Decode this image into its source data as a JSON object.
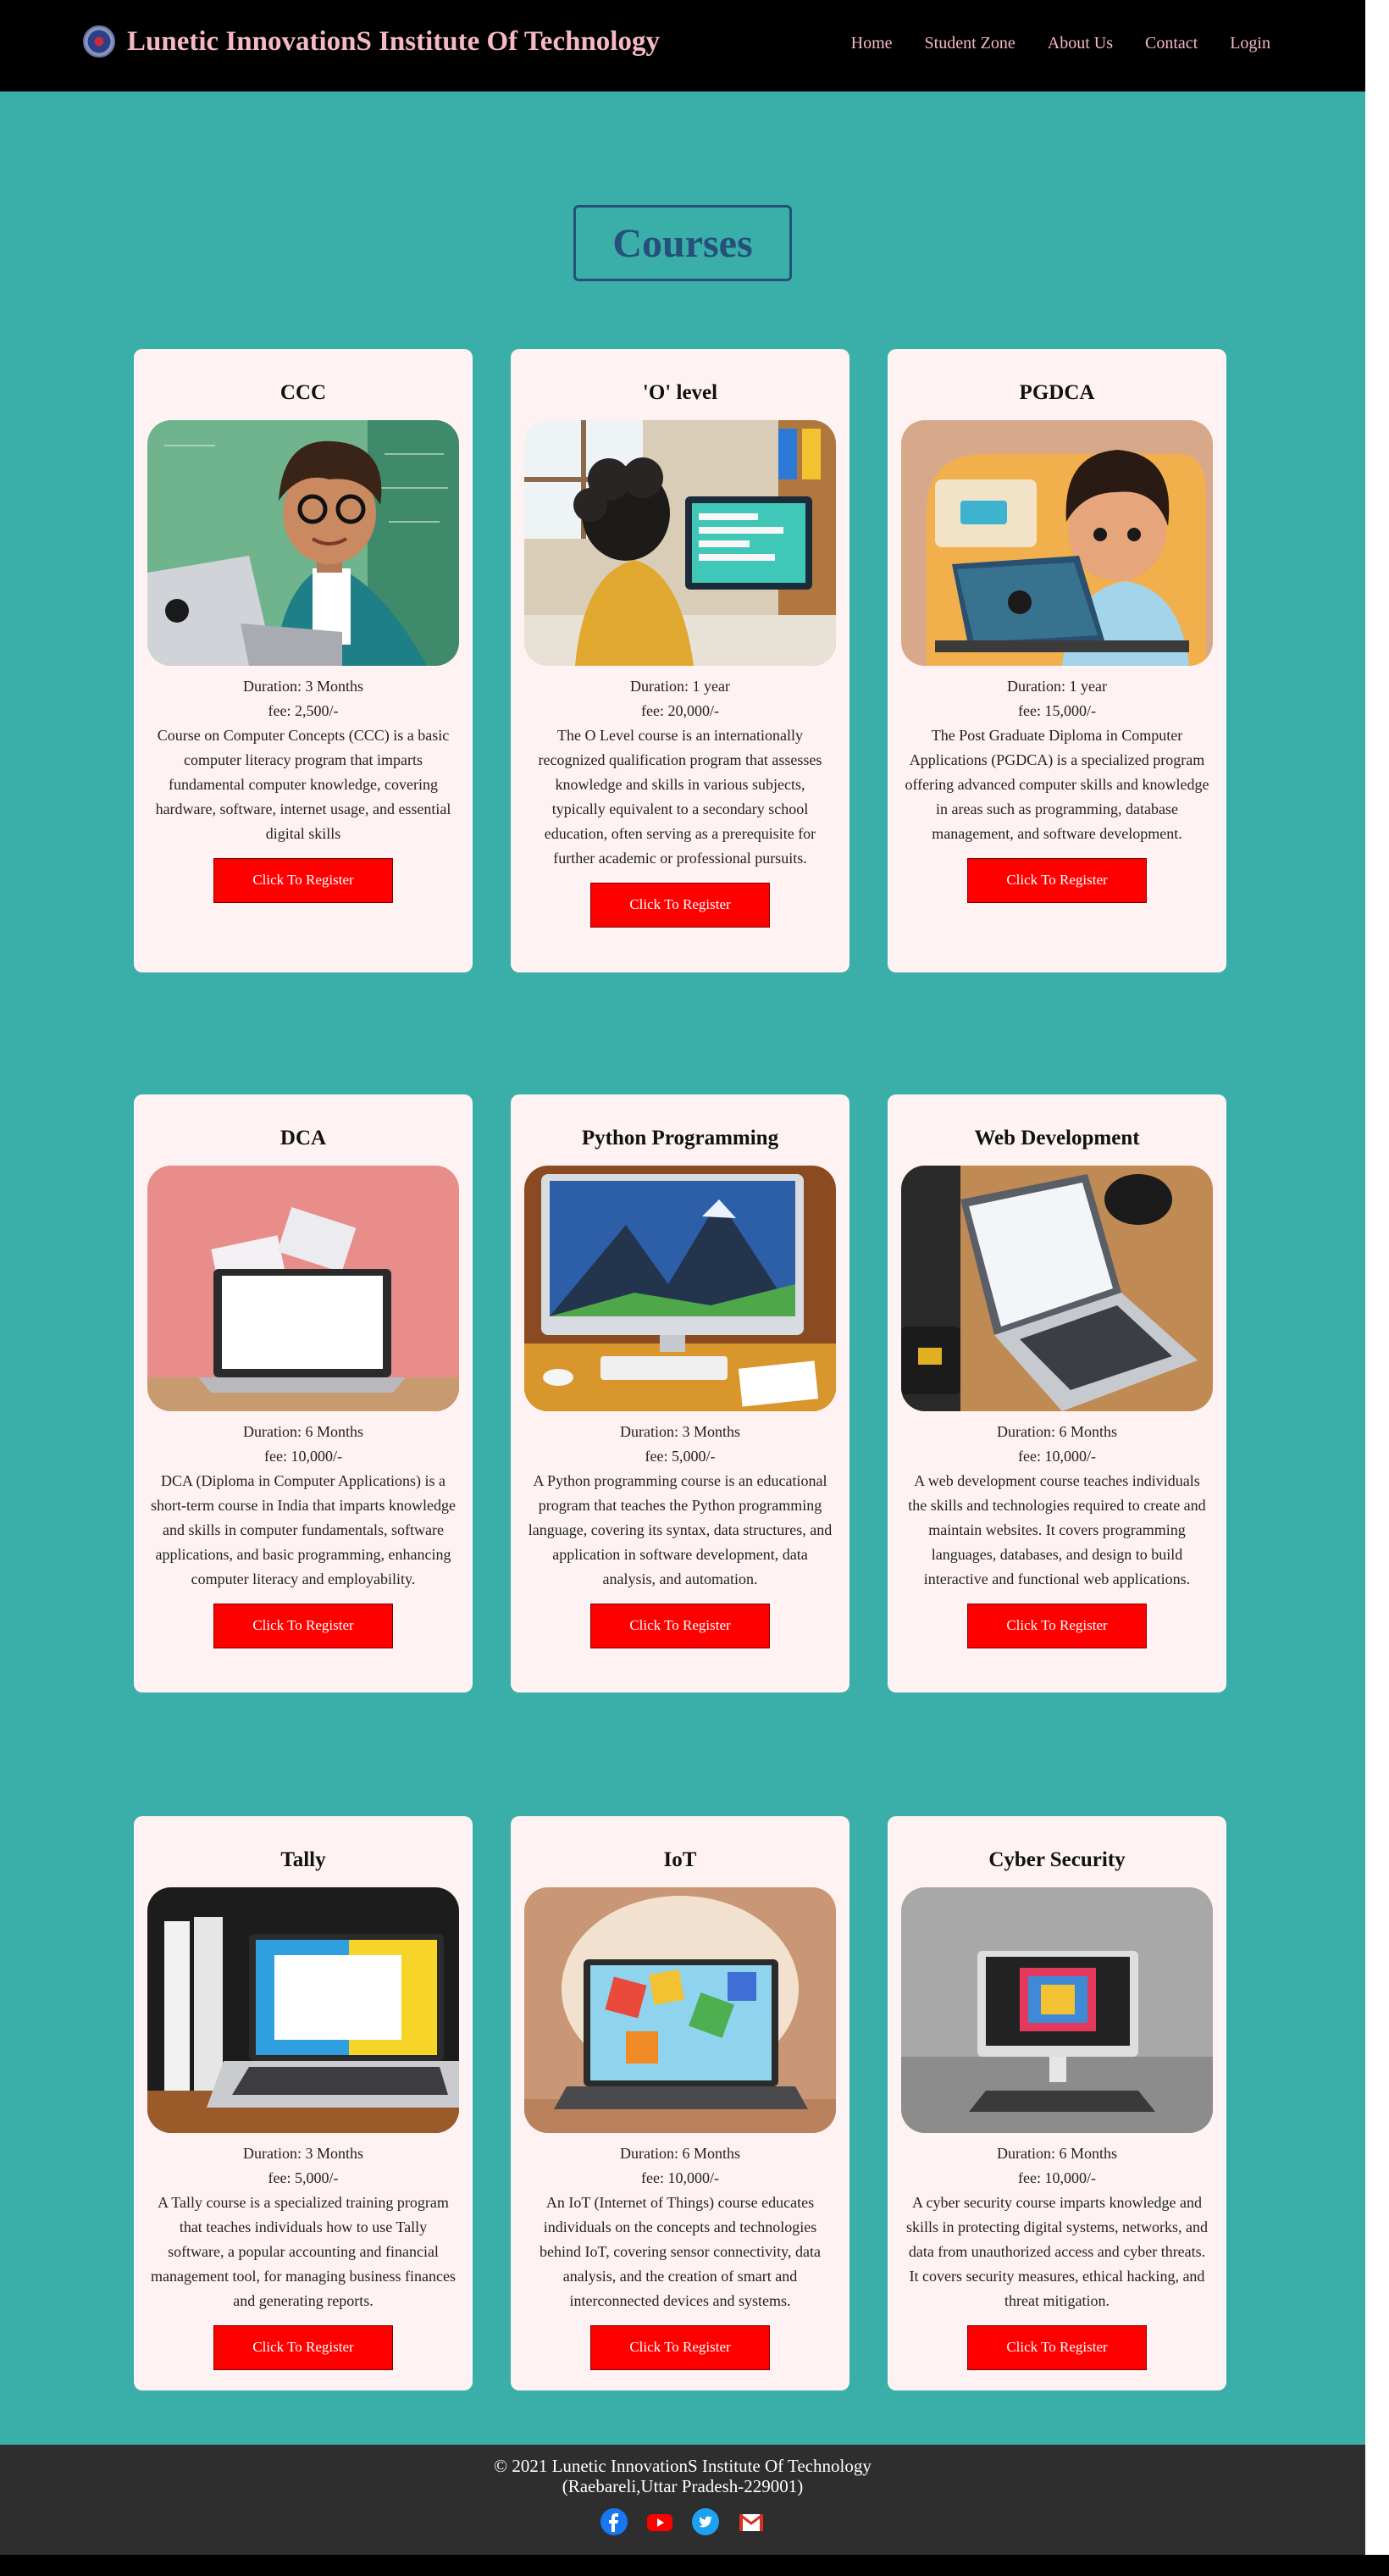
{
  "header": {
    "brand_title": "Lunetic InnovationS Institute Of Technology",
    "nav": [
      "Home",
      "Student Zone",
      "About Us",
      "Contact",
      "Login"
    ]
  },
  "heading": "Courses",
  "courses": [
    {
      "title": "CCC",
      "duration": "Duration: 3 Months",
      "fee": "fee: 2,500/-",
      "description": "Course on Computer Concepts (CCC) is a basic computer literacy program that imparts fundamental computer knowledge, covering hardware, software, internet usage, and essential digital skills",
      "button": "Click To Register",
      "image": "boy-with-laptop-classroom"
    },
    {
      "title": "'O' level",
      "duration": "Duration: 1 year",
      "fee": "fee: 20,000/-",
      "description": "The O Level course is an internationally recognized qualification program that assesses knowledge and skills in various subjects, typically equivalent to a secondary school education, often serving as a prerequisite for further academic or professional pursuits.",
      "button": "Click To Register",
      "image": "child-at-computer"
    },
    {
      "title": "PGDCA",
      "duration": "Duration: 1 year",
      "fee": "fee: 15,000/-",
      "description": "The Post Graduate Diploma in Computer Applications (PGDCA) is a specialized program offering advanced computer skills and knowledge in areas such as programming, database management, and software development.",
      "button": "Click To Register",
      "image": "cartoon-boy-laptop"
    },
    {
      "title": "DCA",
      "duration": "Duration: 6 Months",
      "fee": "fee: 10,000/-",
      "description": "DCA (Diploma in Computer Applications) is a short-term course in India that imparts knowledge and skills in computer fundamentals, software applications, and basic programming, enhancing computer literacy and employability.",
      "button": "Click To Register",
      "image": "laptop-pink-wall"
    },
    {
      "title": "Python Programming",
      "duration": "Duration: 3 Months",
      "fee": "fee: 5,000/-",
      "description": "A Python programming course is an educational program that teaches the Python programming language, covering its syntax, data structures, and application in software development, data analysis, and automation.",
      "button": "Click To Register",
      "image": "desktop-mountain-wallpaper"
    },
    {
      "title": "Web Development",
      "duration": "Duration: 6 Months",
      "fee": "fee: 10,000/-",
      "description": "A web development course teaches individuals the skills and technologies required to create and maintain websites. It covers programming languages, databases, and design to build interactive and functional web applications.",
      "button": "Click To Register",
      "image": "laptop-on-desk"
    },
    {
      "title": "Tally",
      "duration": "Duration: 3 Months",
      "fee": "fee: 5,000/-",
      "description": "A Tally course is a specialized training program that teaches individuals how to use Tally software, a popular accounting and financial management tool, for managing business finances and generating reports.",
      "button": "Click To Register",
      "image": "laptop-with-binders"
    },
    {
      "title": "IoT",
      "duration": "Duration: 6 Months",
      "fee": "fee: 10,000/-",
      "description": "An IoT (Internet of Things) course educates individuals on the concepts and technologies behind IoT, covering sensor connectivity, data analysis, and the creation of smart and interconnected devices and systems.",
      "button": "Click To Register",
      "image": "laptop-colorful-cubes"
    },
    {
      "title": "Cyber Security",
      "duration": "Duration: 6 Months",
      "fee": "fee: 10,000/-",
      "description": "A cyber security course imparts knowledge and skills in protecting digital systems, networks, and data from unauthorized access and cyber threats. It covers security measures, ethical hacking, and threat mitigation.",
      "button": "Click To Register",
      "image": "monitor-grey-room"
    }
  ],
  "footer": {
    "copyright": "© 2021 Lunetic InnovationS Institute Of Technology",
    "address": "(Raebareli,Uttar Pradesh-229001)",
    "socials": [
      "facebook-icon",
      "youtube-icon",
      "twitter-icon",
      "gmail-icon"
    ]
  },
  "colors": {
    "page_bg": "#3aaea8",
    "header_bg": "#000000",
    "brand": "#f6b9c4",
    "heading": "#24507a",
    "card_bg": "#fef2f2",
    "button": "#ff0000",
    "footer_bg": "#2e2e2e"
  }
}
